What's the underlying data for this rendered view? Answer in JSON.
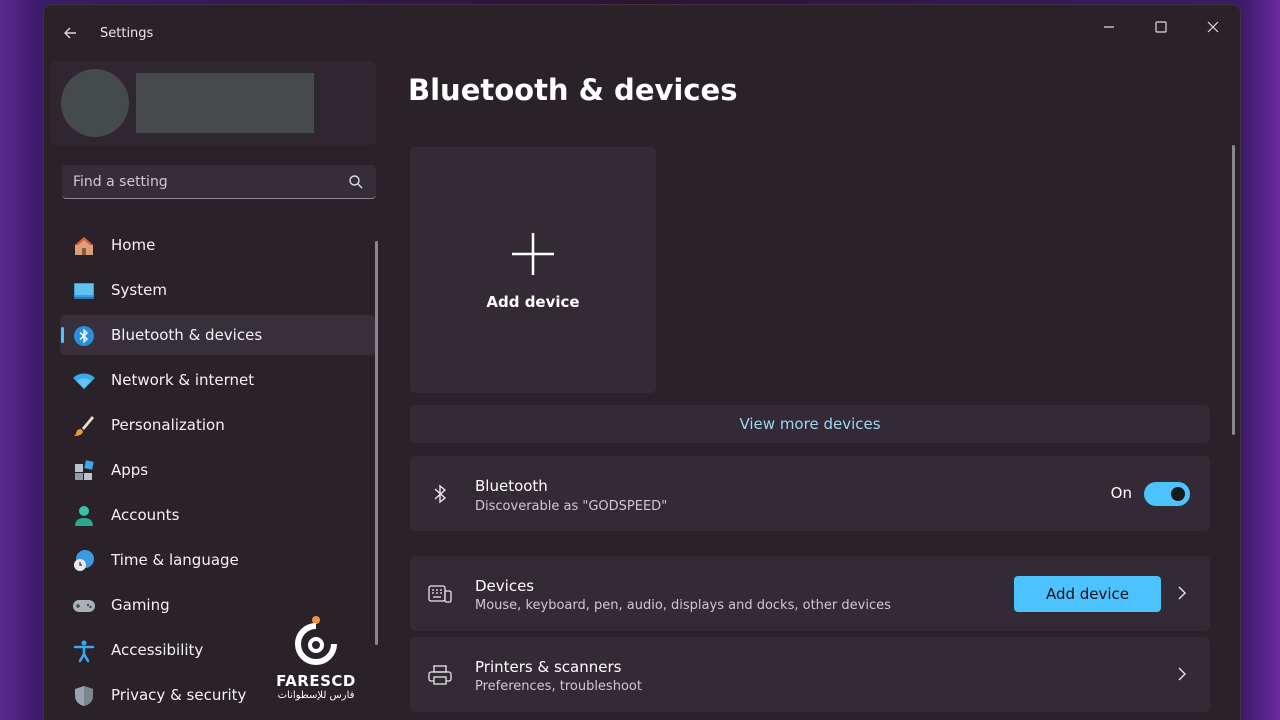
{
  "window": {
    "title": "Settings"
  },
  "search": {
    "placeholder": "Find a setting"
  },
  "sidebar": {
    "items": [
      {
        "label": "Home",
        "icon": "home-icon",
        "active": false
      },
      {
        "label": "System",
        "icon": "system-icon",
        "active": false
      },
      {
        "label": "Bluetooth & devices",
        "icon": "bluetooth-icon",
        "active": true
      },
      {
        "label": "Network & internet",
        "icon": "wifi-icon",
        "active": false
      },
      {
        "label": "Personalization",
        "icon": "brush-icon",
        "active": false
      },
      {
        "label": "Apps",
        "icon": "apps-icon",
        "active": false
      },
      {
        "label": "Accounts",
        "icon": "person-icon",
        "active": false
      },
      {
        "label": "Time & language",
        "icon": "globe-clock-icon",
        "active": false
      },
      {
        "label": "Gaming",
        "icon": "gamepad-icon",
        "active": false
      },
      {
        "label": "Accessibility",
        "icon": "accessibility-icon",
        "active": false
      },
      {
        "label": "Privacy & security",
        "icon": "shield-icon",
        "active": false
      }
    ]
  },
  "main": {
    "title": "Bluetooth & devices",
    "add_device_card": {
      "label": "Add device"
    },
    "view_more_label": "View more devices",
    "bluetooth_row": {
      "title": "Bluetooth",
      "subtitle": "Discoverable as \"GODSPEED\"",
      "toggle_label": "On",
      "toggle_on": true
    },
    "devices_row": {
      "title": "Devices",
      "subtitle": "Mouse, keyboard, pen, audio, displays and docks, other devices",
      "button_label": "Add device"
    },
    "printers_row": {
      "title": "Printers & scanners",
      "subtitle": "Preferences, troubleshoot"
    }
  },
  "watermark": {
    "brand": "FARESCD",
    "subtitle": "فارس للإسطوانات"
  },
  "colors": {
    "accent": "#4cc2ff",
    "window_bg": "#2a2129",
    "card_bg": "#332a35",
    "link": "#9fd5f5"
  }
}
